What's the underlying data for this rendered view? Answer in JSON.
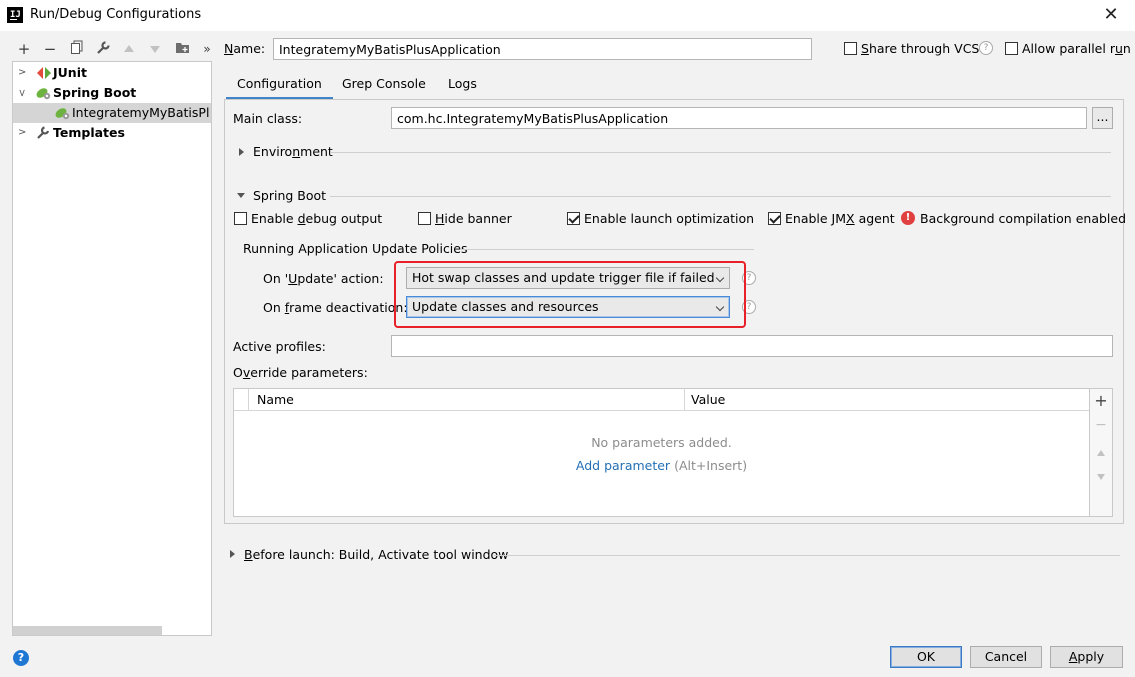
{
  "window": {
    "title": "Run/Debug Configurations",
    "app_icon_text": "IJ"
  },
  "tree": {
    "items": [
      {
        "label": "JUnit"
      },
      {
        "label": "Spring Boot"
      },
      {
        "label": "IntegratemyMyBatisPlusApplication"
      },
      {
        "label": "Templates"
      }
    ]
  },
  "name": {
    "label": "Name:",
    "value": "IntegratemyMyBatisPlusApplication"
  },
  "options": {
    "share_vcs": "Share through VCS",
    "allow_parallel": "Allow parallel run"
  },
  "tabs": [
    {
      "label": "Configuration"
    },
    {
      "label": "Grep Console"
    },
    {
      "label": "Logs"
    }
  ],
  "config": {
    "main_class_label": "Main class:",
    "main_class_value": "com.hc.IntegratemyMyBatisPlusApplication",
    "browse_label": "...",
    "environment": "Environment",
    "spring_boot": "Spring Boot",
    "enable_debug_output": "Enable debug output",
    "hide_banner": "Hide banner",
    "enable_launch_optimization": "Enable launch optimization",
    "enable_jmx_agent": "Enable JMX agent",
    "background_compilation": "Background compilation enabled",
    "policies_title": "Running Application Update Policies",
    "on_update_label": "On 'Update' action:",
    "on_update_value": "Hot swap classes and update trigger file if failed",
    "on_frame_label": "On frame deactivation:",
    "on_frame_value": "Update classes and resources",
    "active_profiles_label": "Active profiles:",
    "active_profiles_value": "",
    "override_label": "Override parameters:",
    "table": {
      "columns": [
        "Name",
        "Value"
      ],
      "empty_text": "No parameters added.",
      "add_link": "Add parameter",
      "add_shortcut": "(Alt+Insert)"
    },
    "before_launch": "Before launch: Build, Activate tool window"
  },
  "checkbox_state": {
    "share_vcs": false,
    "allow_parallel": false,
    "debug_output": false,
    "hide_banner": false,
    "launch_optimization": true,
    "jmx_agent": true
  },
  "buttons": {
    "ok": "OK",
    "cancel": "Cancel",
    "apply": "Apply"
  },
  "icons": [
    "add-icon",
    "remove-icon",
    "copy-icon",
    "wrench-icon",
    "move-up-icon",
    "move-down-icon",
    "folder-icon",
    "more-icon",
    "help-icon",
    "close-icon",
    "error-icon"
  ],
  "colors": {
    "accent": "#4083c9",
    "highlight_box": "#e8202a",
    "link": "#2470b3",
    "error": "#e0403f"
  }
}
